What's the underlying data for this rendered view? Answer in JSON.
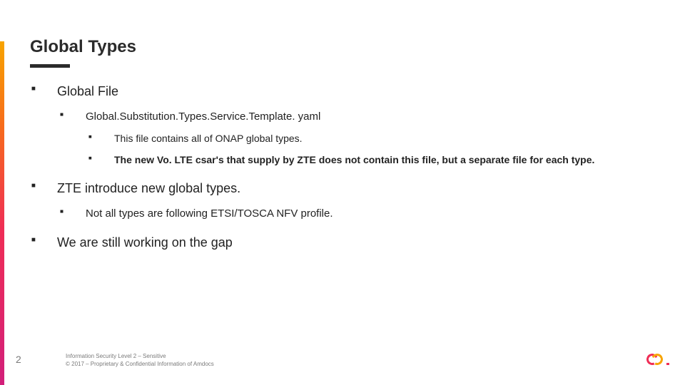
{
  "title": "Global Types",
  "bullets": {
    "b1": "Global File",
    "b1_1": "Global.Substitution.Types.Service.Template. yaml",
    "b1_1_1": "This file contains all of ONAP global types.",
    "b1_1_2": "The new Vo. LTE csar's that supply by ZTE does not contain this file, but a separate file for each type.",
    "b2": "ZTE introduce new global types.",
    "b2_1": "Not all types are following ETSI/TOSCA NFV profile.",
    "b3": "We are still working on the gap"
  },
  "page_number": "2",
  "footer": {
    "line1": "Information Security Level 2 – Sensitive",
    "line2": "© 2017 – Proprietary & Confidential Information of Amdocs"
  }
}
